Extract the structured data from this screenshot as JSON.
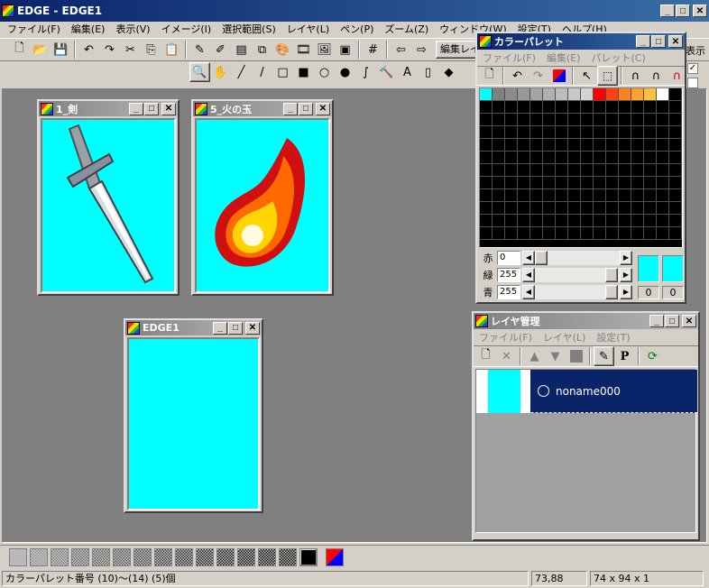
{
  "app": {
    "title": "EDGE - EDGE1"
  },
  "menu": [
    "ファイル(F)",
    "編集(E)",
    "表示(V)",
    "イメージ(I)",
    "選択範囲(S)",
    "レイヤ(L)",
    "ペン(P)",
    "ズーム(Z)",
    "ウィンドウ(W)",
    "設定(T)",
    "ヘルプ(H)"
  ],
  "toolbar": {
    "edit_layer_label": "編集レイ",
    "display_label": "表示",
    "icons": [
      "new-file-icon",
      "open-folder-icon",
      "save-icon",
      "undo-icon",
      "redo-icon",
      "cut-icon",
      "copy-icon",
      "paste-icon",
      "pen-flip-icon",
      "pen-icon",
      "grid-lines-icon",
      "layers-icon",
      "palette-icon",
      "film-icon",
      "image-icon",
      "frame-icon",
      "grid-icon",
      "prev-icon",
      "next-icon"
    ],
    "draw_tools": [
      "zoom-icon",
      "hand-icon",
      "brush-icon",
      "line-icon",
      "rect-icon",
      "filled-rect-icon",
      "ellipse-icon",
      "filled-ellipse-icon",
      "curve-icon",
      "hammer-icon",
      "text-icon",
      "bucket-icon",
      "fill-icon"
    ],
    "draw_glyphs": [
      "🔍",
      "✋",
      "╱",
      "/",
      "□",
      "■",
      "○",
      "●",
      "∫",
      "🔨",
      "A",
      "▯",
      "◆"
    ]
  },
  "windows": {
    "sword": {
      "title": "1_剣"
    },
    "fire": {
      "title": "5_火の玉"
    },
    "edge1": {
      "title": "EDGE1"
    }
  },
  "palette": {
    "title": "カラーパレット",
    "menu": [
      "ファイル(F)",
      "編集(E)",
      "パレット(C)"
    ],
    "top_row_colors": [
      "#00ffff",
      "#808080",
      "#8c8c8c",
      "#989898",
      "#a4a4a4",
      "#b0b0b0",
      "#bcbcbc",
      "#c8c8c8",
      "#d4d4d4",
      "#ff0000",
      "#ff4010",
      "#ff8020",
      "#ffa030",
      "#ffc040",
      "#ffffff",
      "#000000"
    ],
    "rgb": [
      {
        "label": "赤",
        "value": "0"
      },
      {
        "label": "緑",
        "value": "255"
      },
      {
        "label": "青",
        "value": "255"
      }
    ],
    "slots": [
      "0",
      "0"
    ],
    "fg_color": "#00ffff",
    "bg_color": "#00ffff"
  },
  "layers": {
    "title": "レイヤ管理",
    "menu": [
      "ファイル(F)",
      "レイヤ(L)",
      "設定(T)"
    ],
    "items": [
      {
        "name": "noname000"
      }
    ]
  },
  "status": {
    "message": "カラーパレット番号 (10)～(14) (5)個",
    "coords": "73,88",
    "size": "74 x 94 x 1"
  },
  "colors": {
    "canvas": "#00ffff",
    "desktop": "#808080",
    "title_active": "#0a246a"
  }
}
